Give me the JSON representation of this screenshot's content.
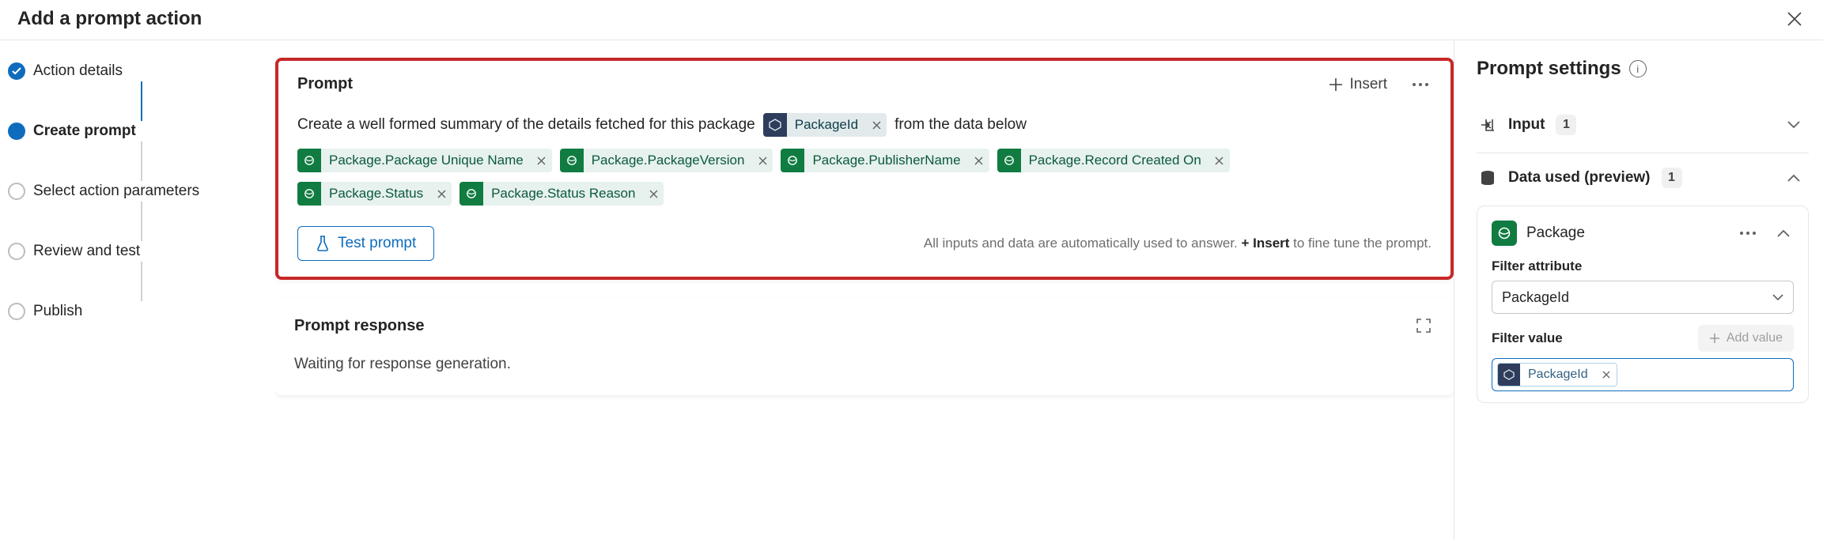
{
  "header": {
    "title": "Add a prompt action"
  },
  "nav": {
    "steps": [
      {
        "label": "Action details",
        "state": "done"
      },
      {
        "label": "Create prompt",
        "state": "current"
      },
      {
        "label": "Select action parameters",
        "state": "pending"
      },
      {
        "label": "Review and test",
        "state": "pending"
      },
      {
        "label": "Publish",
        "state": "pending"
      }
    ]
  },
  "prompt": {
    "title": "Prompt",
    "insert_label": "Insert",
    "text_before": "Create a well formed summary of the details fetched for this package",
    "text_after": "from the data below",
    "id_chip": {
      "label": "PackageId"
    },
    "chips": [
      {
        "label": "Package.Package Unique Name"
      },
      {
        "label": "Package.PackageVersion"
      },
      {
        "label": "Package.PublisherName"
      },
      {
        "label": "Package.Record Created On"
      },
      {
        "label": "Package.Status"
      },
      {
        "label": "Package.Status Reason"
      }
    ],
    "test_label": "Test prompt",
    "hint_before": "All inputs and data are automatically used to answer. ",
    "hint_bold": "+ Insert",
    "hint_after": " to fine tune the prompt."
  },
  "response": {
    "title": "Prompt response",
    "body": "Waiting for response generation."
  },
  "settings": {
    "title": "Prompt settings",
    "input_section": {
      "label": "Input",
      "count": "1"
    },
    "data_section": {
      "label": "Data used (preview)",
      "count": "1"
    },
    "package": {
      "name": "Package",
      "filter_attribute_label": "Filter attribute",
      "filter_attribute_value": "PackageId",
      "filter_value_label": "Filter value",
      "add_value_label": "Add value",
      "filter_value_chip": "PackageId"
    }
  }
}
